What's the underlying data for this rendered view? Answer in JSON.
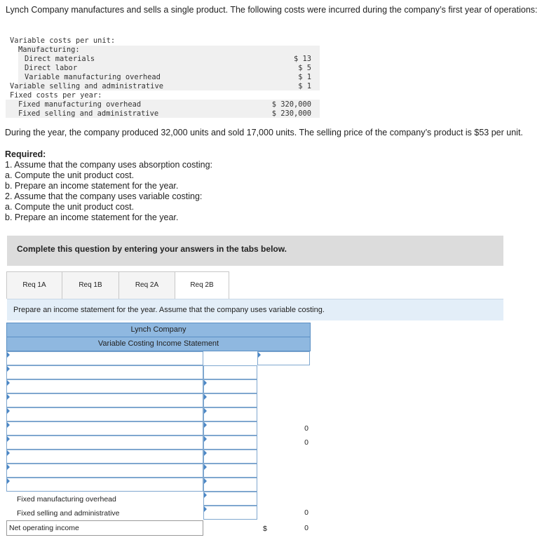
{
  "intro": "Lynch Company manufactures and sells a single product. The following costs were incurred during the company’s first year of operations:",
  "costs": {
    "variable_header": "Variable costs per unit:",
    "manufacturing": "Manufacturing:",
    "direct_materials": "Direct materials",
    "direct_labor": "Direct labor",
    "var_mfg_overhead": "Variable manufacturing overhead",
    "var_sell_admin": "Variable selling and administrative",
    "fixed_header": "Fixed costs per year:",
    "fixed_mfg_overhead": "Fixed manufacturing overhead",
    "fixed_sell_admin": "Fixed selling and administrative",
    "v_dm": "$ 13",
    "v_dl": "$ 5",
    "v_vmo": "$ 1",
    "v_vsa": "$ 1",
    "v_fmo": "$ 320,000",
    "v_fsa": "$ 230,000"
  },
  "production_text": "During the year, the company produced 32,000 units and sold 17,000 units. The selling price of the company’s product is $53 per unit.",
  "required": {
    "title": "Required:",
    "l1": "1. Assume that the company uses absorption costing:",
    "l2": "a. Compute the unit product cost.",
    "l3": "b. Prepare an income statement for the year.",
    "l4": "2. Assume that the company uses variable costing:",
    "l5": "a. Compute the unit product cost.",
    "l6": "b. Prepare an income statement for the year."
  },
  "banner": "Complete this question by entering your answers in the tabs below.",
  "tabs": [
    "Req 1A",
    "Req 1B",
    "Req 2A",
    "Req 2B"
  ],
  "instruction": "Prepare an income statement for the year. Assume that the company uses variable costing.",
  "statement": {
    "company": "Lynch Company",
    "title": "Variable Costing Income Statement",
    "fixed_mfg_label": "Fixed manufacturing overhead",
    "fixed_sell_label": "Fixed selling and administrative",
    "net_label": "Net operating income",
    "zero": "0",
    "dollar": "$"
  }
}
